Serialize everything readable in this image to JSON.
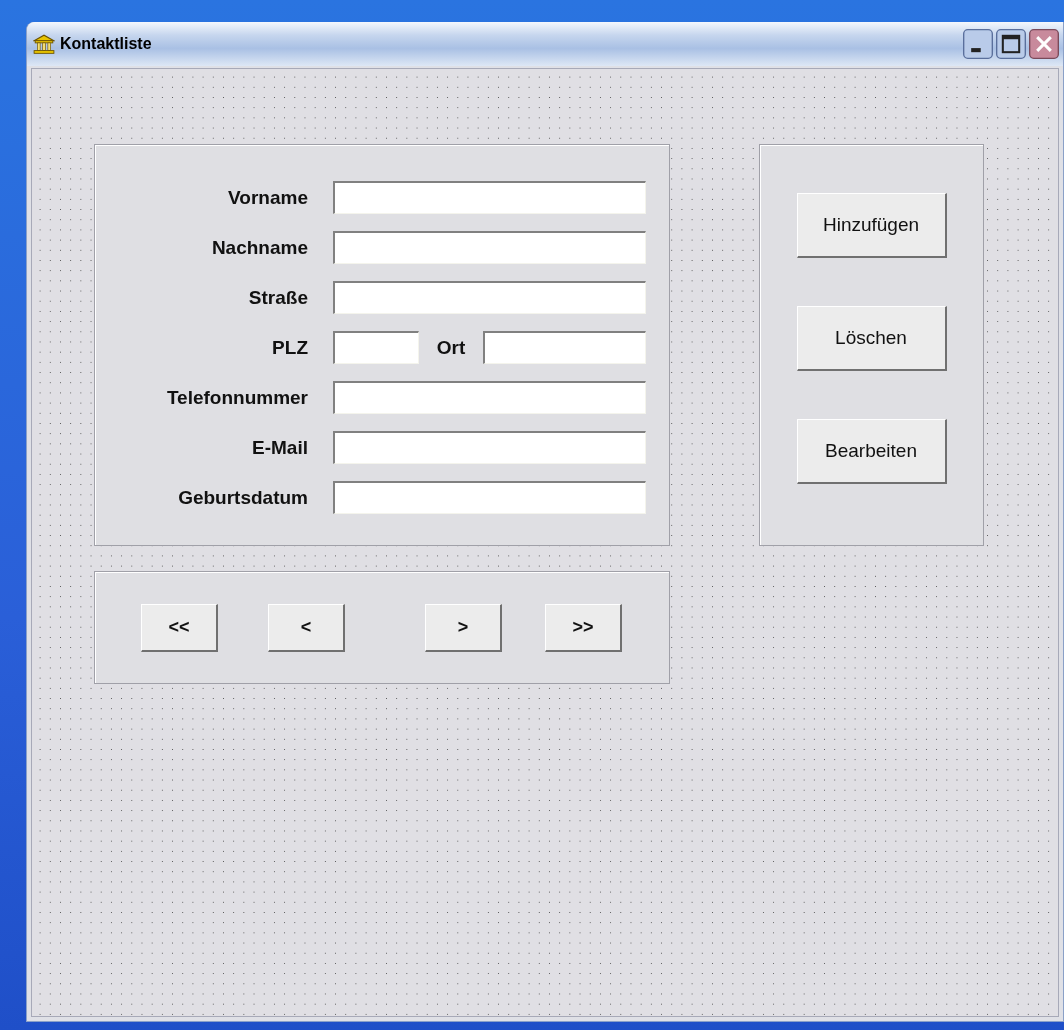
{
  "window": {
    "title": "Kontaktliste"
  },
  "form_rows": [
    {
      "kind": "single",
      "label": "Vorname"
    },
    {
      "kind": "single",
      "label": "Nachname"
    },
    {
      "kind": "single",
      "label": "Straße"
    },
    {
      "kind": "pair",
      "label": "PLZ",
      "second_label": "Ort"
    },
    {
      "kind": "single",
      "label": "Telefonnummer"
    },
    {
      "kind": "single",
      "label": "E-Mail"
    },
    {
      "kind": "single",
      "label": "Geburtsdatum"
    }
  ],
  "action_buttons": [
    "Hinzufügen",
    "Löschen",
    "Bearbeiten"
  ],
  "nav_buttons": [
    "<<",
    "<",
    ">",
    ">>"
  ]
}
